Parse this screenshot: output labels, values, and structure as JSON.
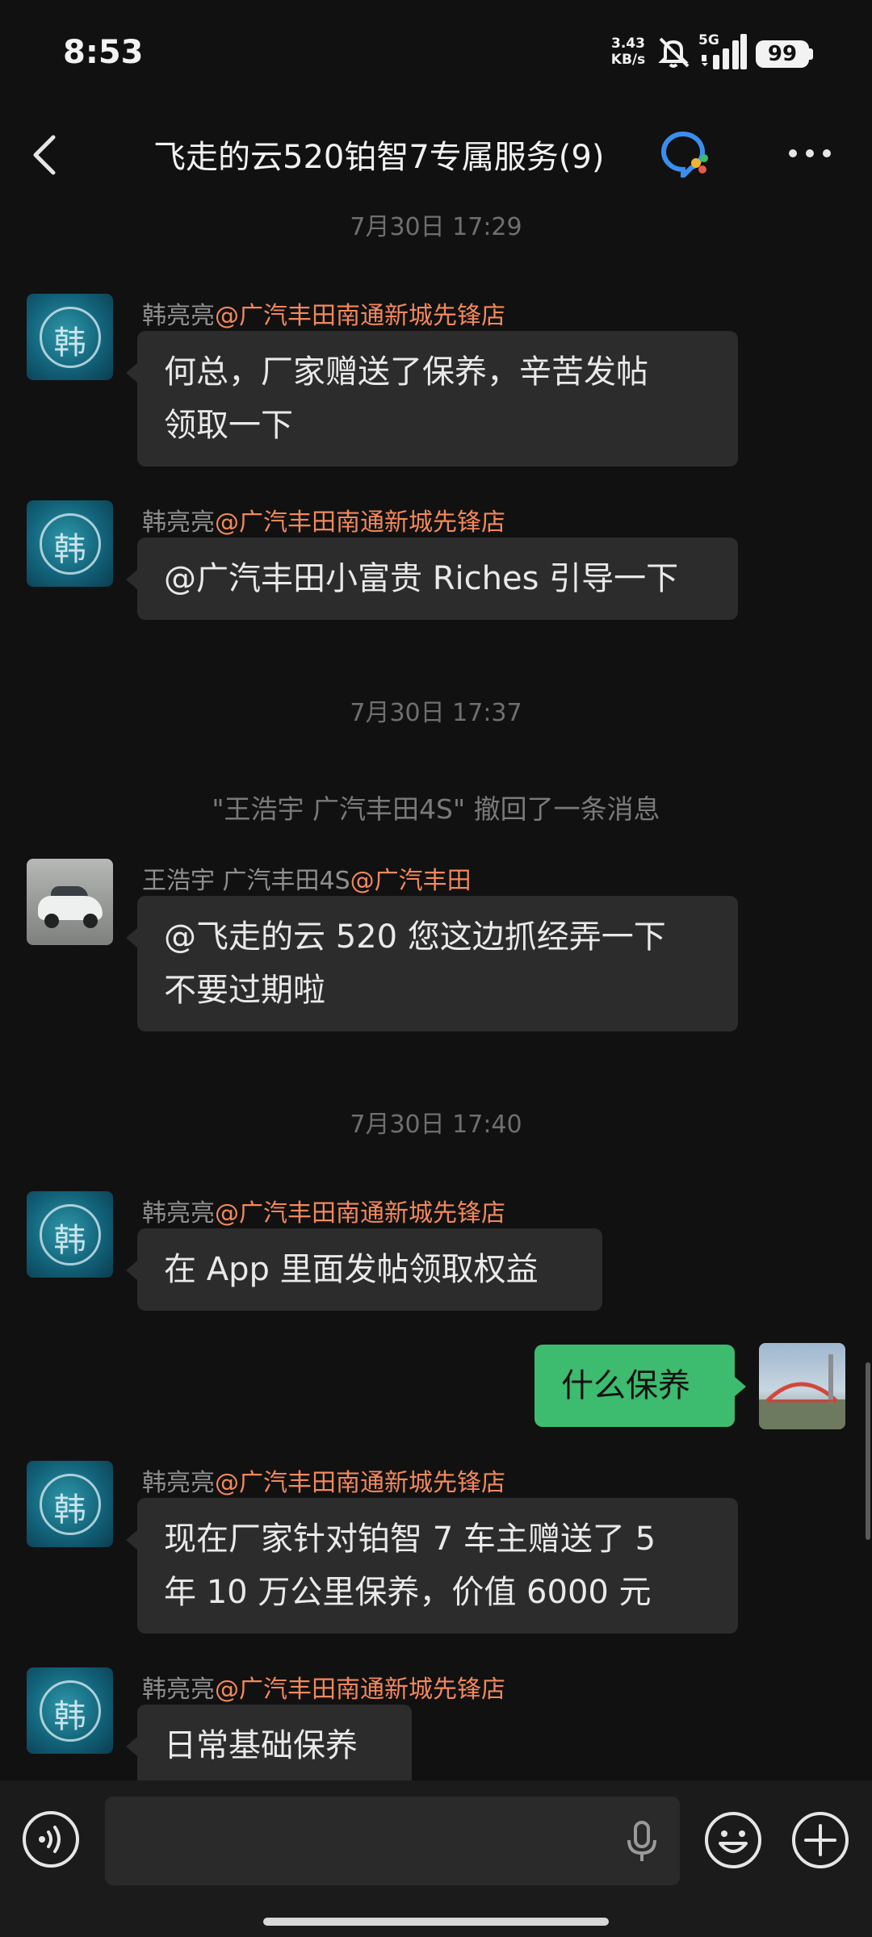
{
  "status_bar": {
    "time": "8:53",
    "net_speed_value": "3.43",
    "net_speed_unit": "KB/s",
    "network": "5G",
    "battery": "99"
  },
  "header": {
    "back_icon": "chevron-left-icon",
    "title": "飞走的云520铂智7专属服务(9)",
    "more_icon": "more-dots-icon"
  },
  "messages": {
    "time1": "7月30日 17:29",
    "msg1": {
      "sender": "韩亮亮",
      "org": "@广汽丰田南通新城先锋店",
      "line1": "何总，厂家赠送了保养，辛苦发帖",
      "line2": "领取一下"
    },
    "msg2": {
      "sender": "韩亮亮",
      "org": "@广汽丰田南通新城先锋店",
      "line1": "@广汽丰田小富贵 Riches 引导一下"
    },
    "time2": "7月30日 17:37",
    "recall": "\"王浩宇 广汽丰田4S\" 撤回了一条消息",
    "msg3": {
      "sender": "王浩宇 广汽丰田4S",
      "org": "@广汽丰田",
      "line1": "@飞走的云 520 您这边抓经弄一下",
      "line2": "不要过期啦"
    },
    "time3": "7月30日 17:40",
    "msg4": {
      "sender": "韩亮亮",
      "org": "@广汽丰田南通新城先锋店",
      "line1": "在 App 里面发帖领取权益"
    },
    "msg5_me": {
      "line1": "什么保养"
    },
    "msg6": {
      "sender": "韩亮亮",
      "org": "@广汽丰田南通新城先锋店",
      "line1": "现在厂家针对铂智 7 车主赠送了 5",
      "line2": "年 10 万公里保养，价值 6000 元"
    },
    "msg7": {
      "sender": "韩亮亮",
      "org": "@广汽丰田南通新城先锋店",
      "line1": "日常基础保养"
    }
  },
  "input_bar": {
    "voice_icon": "voice-mode-icon",
    "placeholder": "",
    "mic_icon": "microphone-icon",
    "emoji_icon": "emoji-icon",
    "plus_icon": "plus-icon"
  },
  "colors": {
    "background": "#111111",
    "bubble_other": "#2c2c2c",
    "bubble_me": "#3dbb6e",
    "org_tag": "#f2885c"
  }
}
